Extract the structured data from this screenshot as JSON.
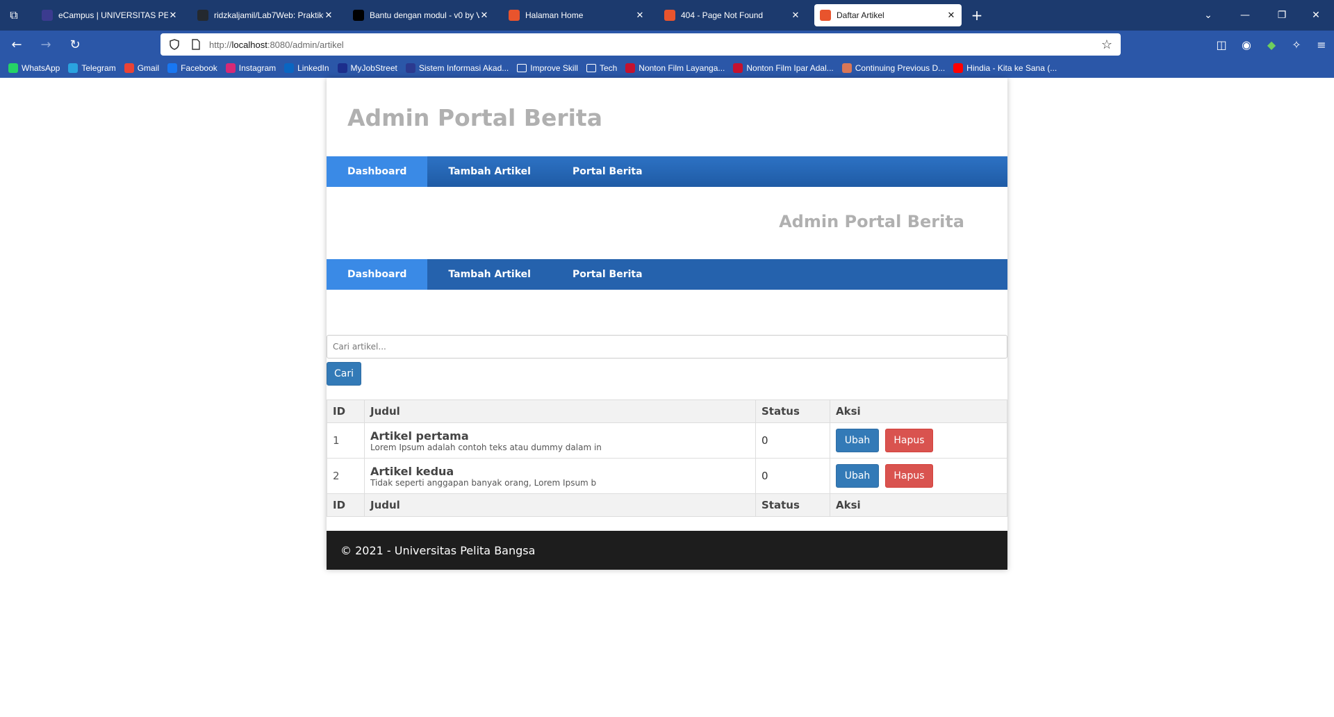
{
  "browser": {
    "tabs": [
      {
        "title": "eCampus | UNIVERSITAS PELITA BANGSA",
        "fav_color": "#3b3b8f",
        "active": false
      },
      {
        "title": "ridzkaljamil/Lab7Web: Praktikum",
        "fav_color": "#24292f",
        "active": false
      },
      {
        "title": "Bantu dengan modul - v0 by Vercel",
        "fav_color": "#000000",
        "active": false
      },
      {
        "title": "Halaman Home",
        "fav_color": "#e8542d",
        "active": false
      },
      {
        "title": "404 - Page Not Found",
        "fav_color": "#e8542d",
        "active": false
      },
      {
        "title": "Daftar Artikel",
        "fav_color": "#e8542d",
        "active": true
      }
    ],
    "url_prefix": "http://",
    "url_host": "localhost",
    "url_rest": ":8080/admin/artikel",
    "bookmarks": [
      {
        "label": "WhatsApp",
        "color": "#25d366"
      },
      {
        "label": "Telegram",
        "color": "#2aa3df"
      },
      {
        "label": "Gmail",
        "color": "#ea4335"
      },
      {
        "label": "Facebook",
        "color": "#1877f2"
      },
      {
        "label": "Instagram",
        "color": "#d62976"
      },
      {
        "label": "LinkedIn",
        "color": "#0a66c2"
      },
      {
        "label": "MyJobStreet",
        "color": "#1c2e8c"
      },
      {
        "label": "Sistem Informasi Akad...",
        "color": "#2b3a8f"
      },
      {
        "label": "Improve Skill",
        "color": "folder"
      },
      {
        "label": "Tech",
        "color": "folder"
      },
      {
        "label": "Nonton Film Layanga...",
        "color": "#c4122f"
      },
      {
        "label": "Nonton Film Ipar Adal...",
        "color": "#c4122f"
      },
      {
        "label": "Continuing Previous D...",
        "color": "#d97757"
      },
      {
        "label": "Hindia - Kita ke Sana (...",
        "color": "#ff0000"
      }
    ]
  },
  "page": {
    "header_title": "Admin Portal Berita",
    "header2_title": "Admin Portal Berita",
    "menu": [
      "Dashboard",
      "Tambah Artikel",
      "Portal Berita"
    ],
    "search_placeholder": "Cari artikel...",
    "search_button": "Cari",
    "table": {
      "headers": [
        "ID",
        "Judul",
        "Status",
        "Aksi"
      ],
      "rows": [
        {
          "id": "1",
          "title": "Artikel pertama",
          "excerpt": "Lorem Ipsum adalah contoh teks atau dummy dalam in",
          "status": "0"
        },
        {
          "id": "2",
          "title": "Artikel kedua",
          "excerpt": "Tidak seperti anggapan banyak orang, Lorem Ipsum b",
          "status": "0"
        }
      ],
      "edit_label": "Ubah",
      "delete_label": "Hapus"
    },
    "footer": "© 2021 - Universitas Pelita Bangsa"
  }
}
